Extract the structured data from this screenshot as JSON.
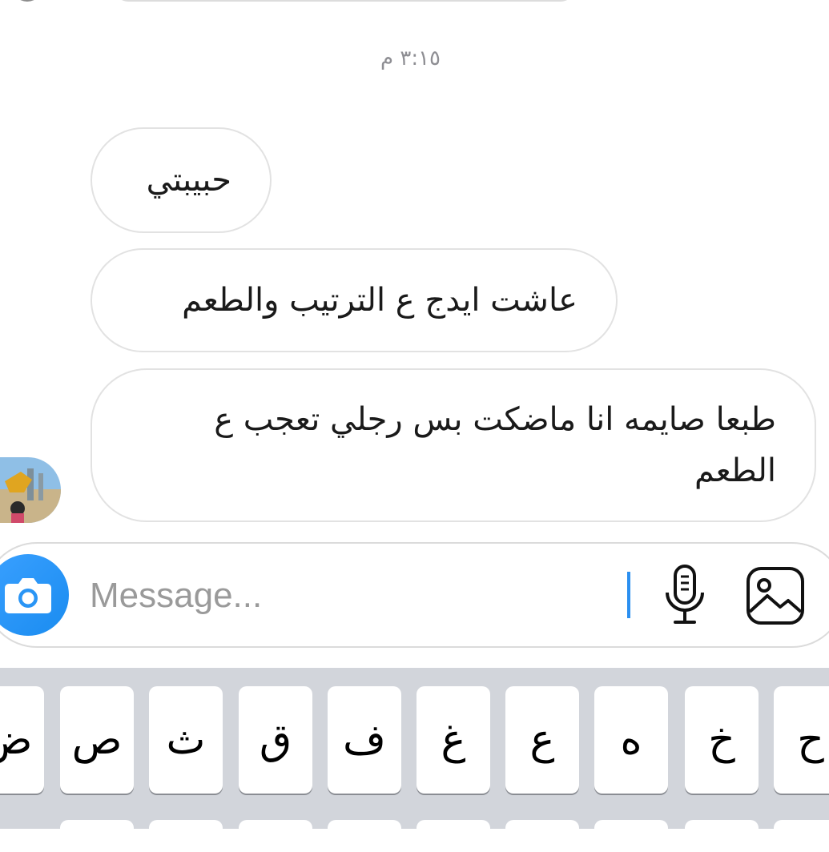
{
  "conversation": {
    "timestamp": "٣:١٥ م",
    "messages": [
      {
        "text": "حبيبتي"
      },
      {
        "text": "عاشت ايدج ع الترتيب والطعم"
      },
      {
        "text": "طبعا صايمه انا ماضكت بس رجلي تعجب ع الطعم"
      }
    ]
  },
  "composer": {
    "placeholder": "Message...",
    "accent_color": "#2b8ff0",
    "icons": [
      "camera-icon",
      "microphone-icon",
      "gallery-icon"
    ]
  },
  "keyboard": {
    "keys": [
      "ح",
      "خ",
      "ه",
      "ع",
      "غ",
      "ف",
      "ق",
      "ث",
      "ص",
      "ض"
    ]
  }
}
